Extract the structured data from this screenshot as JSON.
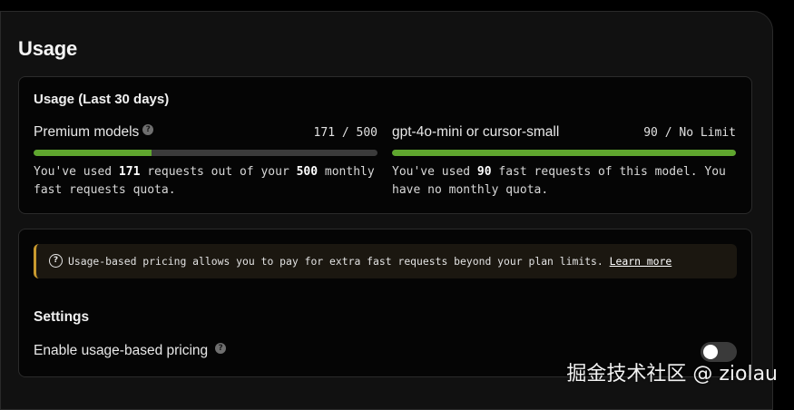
{
  "page": {
    "title": "Usage"
  },
  "usage_card": {
    "title": "Usage (Last 30 days)",
    "premium": {
      "label": "Premium models",
      "used": "171",
      "separator": " / ",
      "limit": "500",
      "fill_fraction": 0.342,
      "desc_prefix": "You've used ",
      "desc_used": "171",
      "desc_middle": " requests out of your ",
      "desc_limit": "500",
      "desc_suffix": " monthly fast requests quota."
    },
    "mini": {
      "label": "gpt-4o-mini or cursor-small",
      "used": "90",
      "separator": " / ",
      "limit": "No Limit",
      "fill_fraction": 1.0,
      "desc_prefix": "You've used ",
      "desc_used": "90",
      "desc_suffix": " fast requests of this model. You have no monthly quota."
    }
  },
  "pricing_card": {
    "notice_text": "Usage-based pricing allows you to pay for extra fast requests beyond your plan limits.",
    "notice_link": "Learn more",
    "settings_title": "Settings",
    "toggle_label": "Enable usage-based pricing",
    "toggle_on": false
  },
  "watermark": "掘金技术社区 @ ziolau",
  "colors": {
    "bar_fill": "#5fa62e",
    "bar_track": "#3b3b3b",
    "notice_accent": "#c99a2e"
  },
  "icons": {
    "help": "question-circle-icon",
    "notice": "question-circle-icon"
  }
}
